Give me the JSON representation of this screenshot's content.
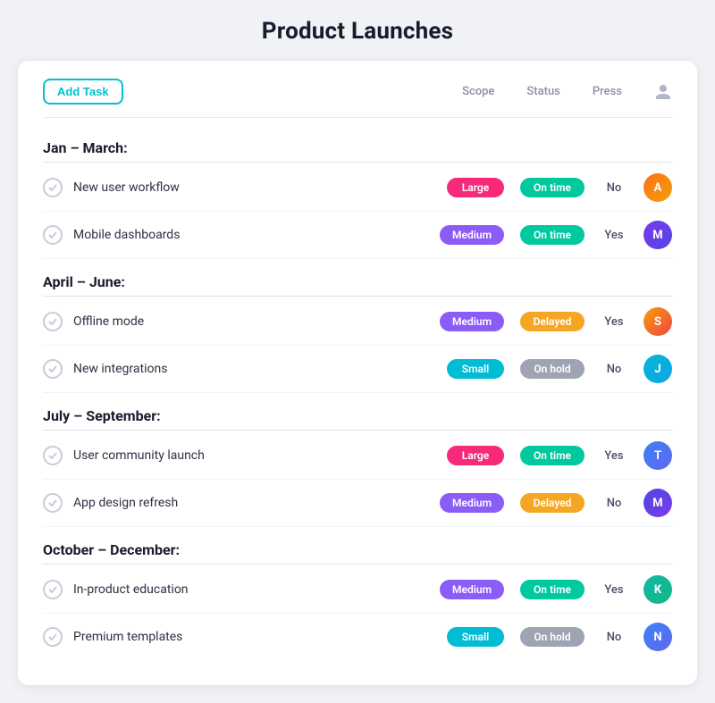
{
  "page": {
    "title": "Product Launches"
  },
  "toolbar": {
    "add_task_label": "Add Task",
    "col_scope": "Scope",
    "col_status": "Status",
    "col_press": "Press"
  },
  "sections": [
    {
      "id": "jan-march",
      "header": "Jan – March:",
      "tasks": [
        {
          "id": "t1",
          "name": "New user workflow",
          "scope": "Large",
          "scope_class": "badge-large",
          "status": "On time",
          "status_class": "status-ontime",
          "press": "No",
          "avatar_class": "avatar-orange",
          "avatar_letter": "A"
        },
        {
          "id": "t2",
          "name": "Mobile dashboards",
          "scope": "Medium",
          "scope_class": "badge-medium",
          "status": "On time",
          "status_class": "status-ontime",
          "press": "Yes",
          "avatar_class": "avatar-purple",
          "avatar_letter": "M"
        }
      ]
    },
    {
      "id": "april-june",
      "header": "April – June:",
      "tasks": [
        {
          "id": "t3",
          "name": "Offline mode",
          "scope": "Medium",
          "scope_class": "badge-medium",
          "status": "Delayed",
          "status_class": "status-delayed",
          "press": "Yes",
          "avatar_class": "avatar-amber",
          "avatar_letter": "S"
        },
        {
          "id": "t4",
          "name": "New integrations",
          "scope": "Small",
          "scope_class": "badge-small",
          "status": "On hold",
          "status_class": "status-onhold",
          "press": "No",
          "avatar_class": "avatar-cyan",
          "avatar_letter": "J"
        }
      ]
    },
    {
      "id": "july-sept",
      "header": "July – September:",
      "tasks": [
        {
          "id": "t5",
          "name": "User community launch",
          "scope": "Large",
          "scope_class": "badge-large",
          "status": "On time",
          "status_class": "status-ontime",
          "press": "Yes",
          "avatar_class": "avatar-blue",
          "avatar_letter": "T"
        },
        {
          "id": "t6",
          "name": "App design refresh",
          "scope": "Medium",
          "scope_class": "badge-medium",
          "status": "Delayed",
          "status_class": "status-delayed",
          "press": "No",
          "avatar_class": "avatar-indigo",
          "avatar_letter": "M"
        }
      ]
    },
    {
      "id": "oct-dec",
      "header": "October – December:",
      "tasks": [
        {
          "id": "t7",
          "name": "In-product education",
          "scope": "Medium",
          "scope_class": "badge-medium",
          "status": "On time",
          "status_class": "status-ontime",
          "press": "Yes",
          "avatar_class": "avatar-teal",
          "avatar_letter": "K"
        },
        {
          "id": "t8",
          "name": "Premium templates",
          "scope": "Small",
          "scope_class": "badge-small",
          "status": "On hold",
          "status_class": "status-onhold",
          "press": "No",
          "avatar_class": "avatar-blue",
          "avatar_letter": "N"
        }
      ]
    }
  ]
}
